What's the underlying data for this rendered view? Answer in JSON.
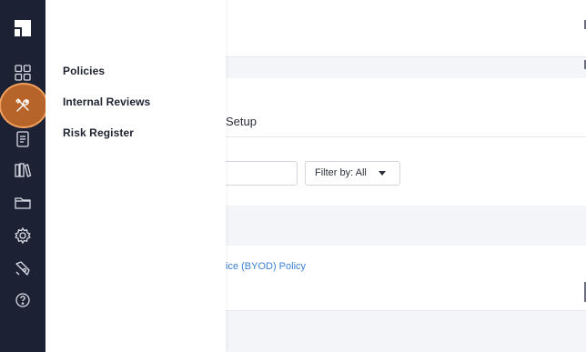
{
  "flyout": {
    "items": [
      {
        "label": "Policies"
      },
      {
        "label": "Internal Reviews"
      },
      {
        "label": "Risk Register"
      }
    ]
  },
  "rail": {
    "icons": [
      "logo-icon",
      "dashboard-icon",
      "tools-icon",
      "document-icon",
      "library-icon",
      "folder-icon",
      "settings-icon",
      "rocket-icon",
      "help-icon"
    ],
    "active": "tools-icon",
    "accent_color": "#f0a15e",
    "background_color": "#1c2233"
  },
  "main": {
    "tab_title": "Setup",
    "filter": {
      "label": "Filter by: All"
    },
    "row_link": "ice (BYOD) Policy"
  }
}
